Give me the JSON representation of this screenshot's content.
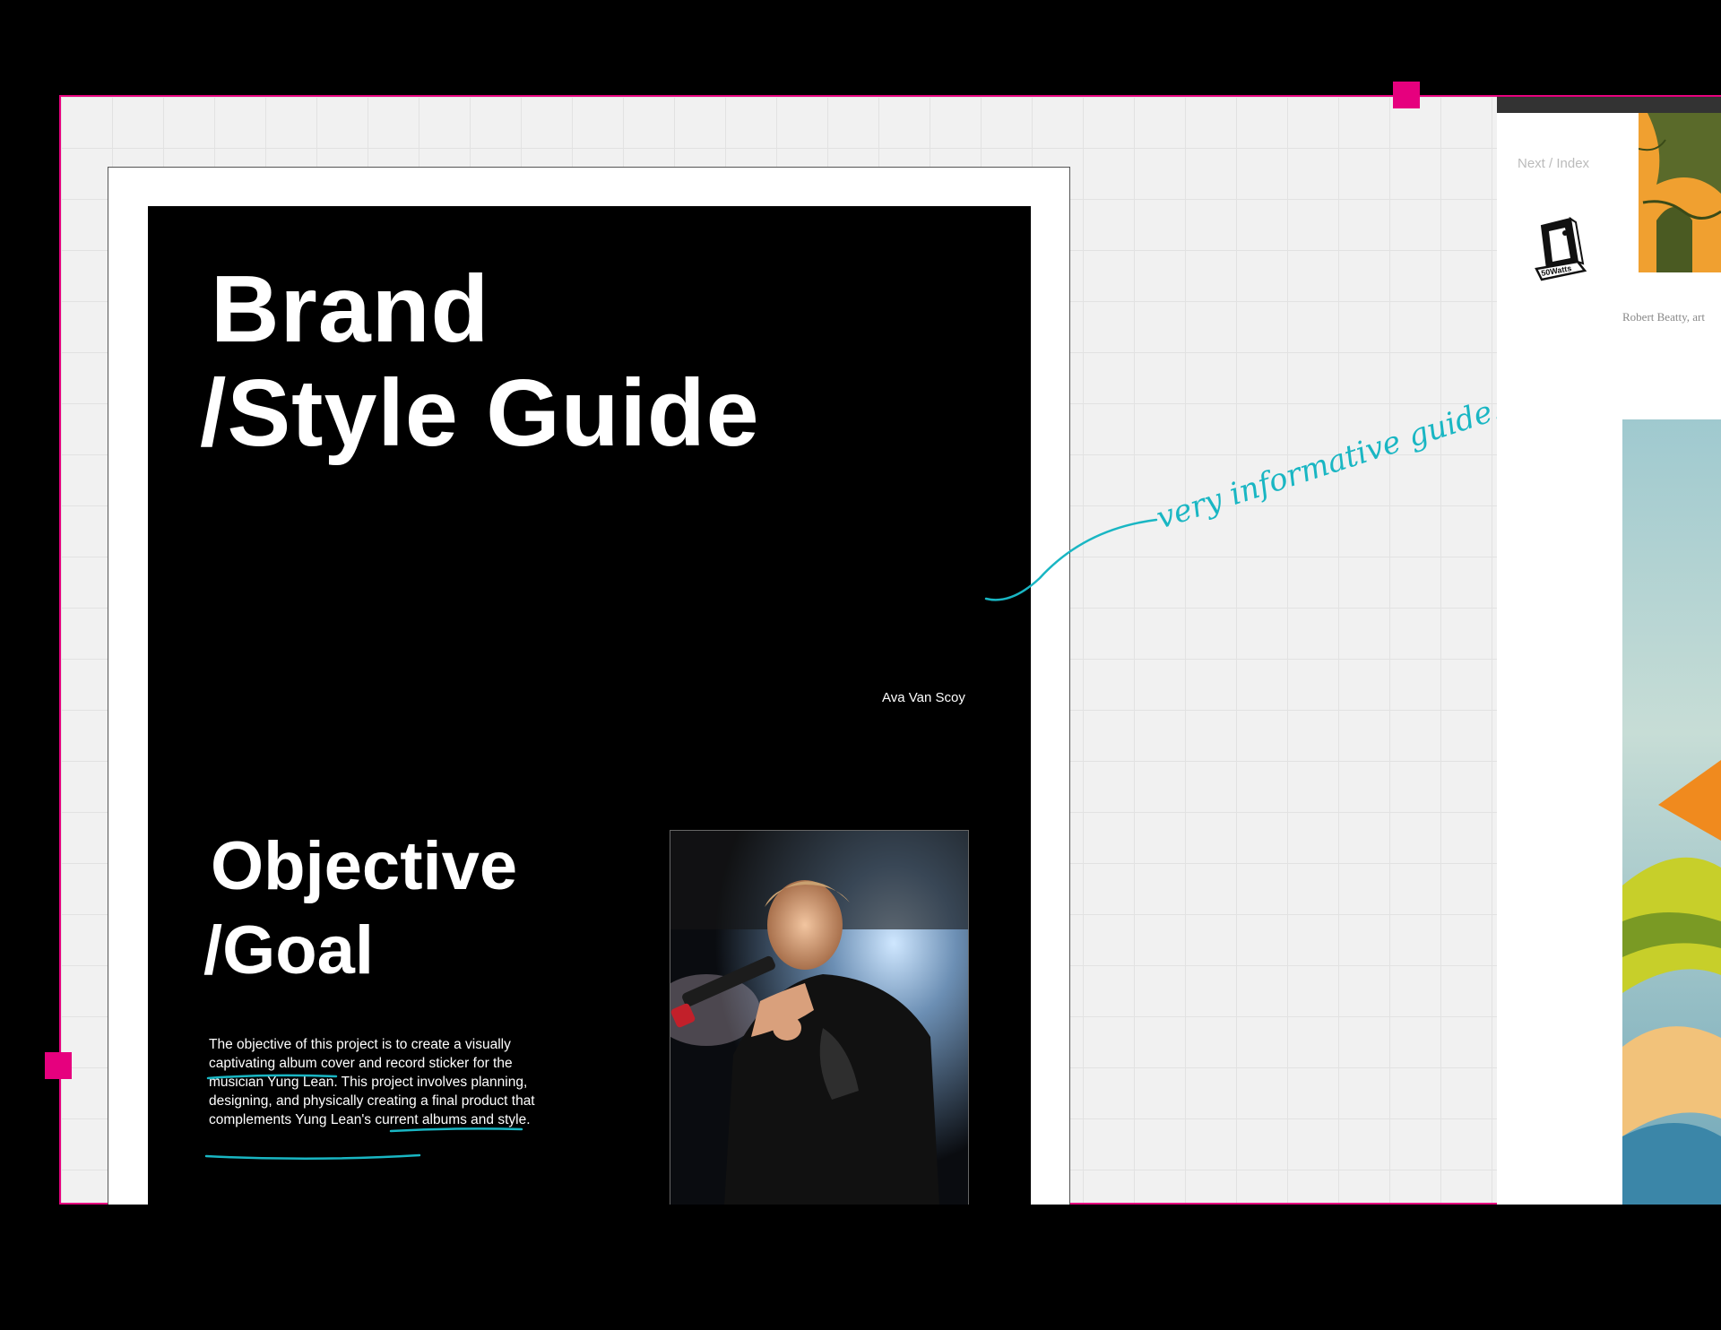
{
  "colors": {
    "accent": "#e6007e",
    "annotation": "#19b6c3",
    "background": "#000000",
    "canvas": "#f1f1f1"
  },
  "document": {
    "title_line1": "Brand",
    "title_line2": "/Style Guide",
    "author": "Ava Van Scoy",
    "objective_line1": "Objective",
    "objective_line2": "/Goal",
    "body": {
      "p1": "The objective of this project is to create a ",
      "hl1": "visually captivating",
      "p2": " album cover and record sticker for the musician Yung Lean. This project involves planning, designing, and physically creating a final product that",
      "hl2": " complements Yung Lean's current albums and style",
      "p3": "."
    }
  },
  "annotation": {
    "note": "very informative guide. thanks!"
  },
  "right_panel": {
    "nav_next": "Next",
    "nav_sep": " / ",
    "nav_index": "Index",
    "logo_label": "50Watts",
    "caption": "Robert Beatty, art"
  }
}
